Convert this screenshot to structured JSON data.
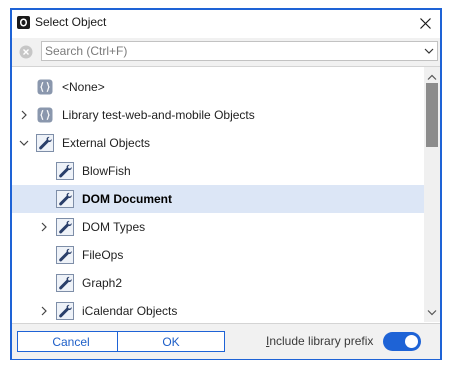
{
  "window": {
    "title": "Select Object",
    "accent_color": "#1e63d6"
  },
  "search": {
    "placeholder": "Search (Ctrl+F)",
    "value": ""
  },
  "tree": {
    "items": [
      {
        "label": "<None>",
        "icon": "object-icon",
        "level": 0,
        "expander": "none",
        "selected": false
      },
      {
        "label": "Library test-web-and-mobile Objects",
        "icon": "object-icon",
        "level": 0,
        "expander": "collapsed",
        "selected": false
      },
      {
        "label": "External Objects",
        "icon": "wrench-icon",
        "level": 0,
        "expander": "expanded",
        "selected": false
      },
      {
        "label": "BlowFish",
        "icon": "wrench-icon",
        "level": 1,
        "expander": "none",
        "selected": false
      },
      {
        "label": "DOM Document",
        "icon": "wrench-icon",
        "level": 1,
        "expander": "none",
        "selected": true
      },
      {
        "label": "DOM Types",
        "icon": "wrench-icon",
        "level": 1,
        "expander": "collapsed",
        "selected": false
      },
      {
        "label": "FileOps",
        "icon": "wrench-icon",
        "level": 1,
        "expander": "none",
        "selected": false
      },
      {
        "label": "Graph2",
        "icon": "wrench-icon",
        "level": 1,
        "expander": "none",
        "selected": false
      },
      {
        "label": "iCalendar Objects",
        "icon": "wrench-icon",
        "level": 1,
        "expander": "collapsed",
        "selected": false
      }
    ]
  },
  "footer": {
    "cancel_label": "Cancel",
    "ok_label": "OK",
    "prefix_label_first": "I",
    "prefix_label_rest": "nclude library prefix",
    "prefix_enabled": true
  }
}
